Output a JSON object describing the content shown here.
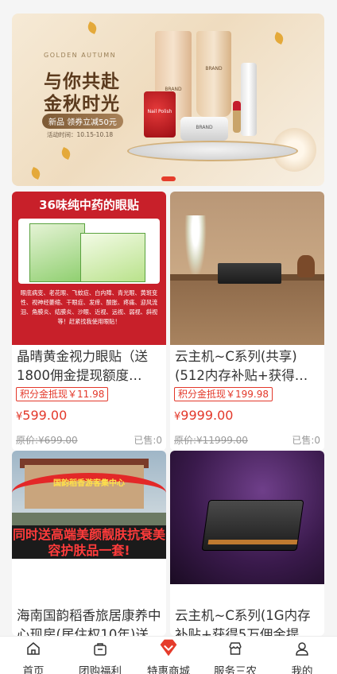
{
  "banner": {
    "en_title": "GOLDEN AUTUMN",
    "title_line1": "与你共赴",
    "title_line2": "金秋时光",
    "coupon": "新品 领券立减50元",
    "time": "活动时间：10.15-10.18",
    "product_labels": [
      "BRAND",
      "BRAND",
      "Nail Polish",
      "BRAND"
    ]
  },
  "products": [
    {
      "image_text": {
        "head": "36味纯中药的眼贴",
        "desc": "眼底病变、老花眼、飞蚊症、白内障、青光眼、黄斑变性、视神经萎缩、干眼症、发痒、酸胀、疼痛、迎风流泪、角膜炎、结膜炎、沙眼、近视、远视、弱视、斜视等！赶紧找我使用眼贴！"
      },
      "title": "晶晴黄金视力眼贴（送1800佣金提现额度+120…",
      "badge": "积分金抵现￥11.98",
      "price_symbol": "¥",
      "price": "599.00",
      "original_price": "原价:¥699.00",
      "sold": "已售:0"
    },
    {
      "title": "云主机~C系列(共享)(512内存补贴+获得20000…",
      "badge": "积分金抵现￥199.98",
      "price_symbol": "¥",
      "price": "9999.00",
      "original_price": "原价:¥11999.00",
      "sold": "已售:0"
    },
    {
      "image_text": {
        "arch": "国韵稻香游客集中心",
        "strip": "同时送高端美颜靓肤抗衰美容护肤品一套!"
      },
      "title": "海南国韵稻香旅居康养中心现房(居住权10年)送…"
    },
    {
      "title": "云主机~C系列(1G内存补贴+获得5万佣金提现额…"
    }
  ],
  "tabbar": {
    "items": [
      {
        "label": "首页",
        "icon": "home-icon"
      },
      {
        "label": "团购福利",
        "icon": "bag-icon"
      },
      {
        "label": "特惠商城",
        "icon": "diamond-icon"
      },
      {
        "label": "服务三农",
        "icon": "shop-icon"
      },
      {
        "label": "我的",
        "icon": "user-icon"
      }
    ],
    "active_color": "#e53c2b"
  }
}
